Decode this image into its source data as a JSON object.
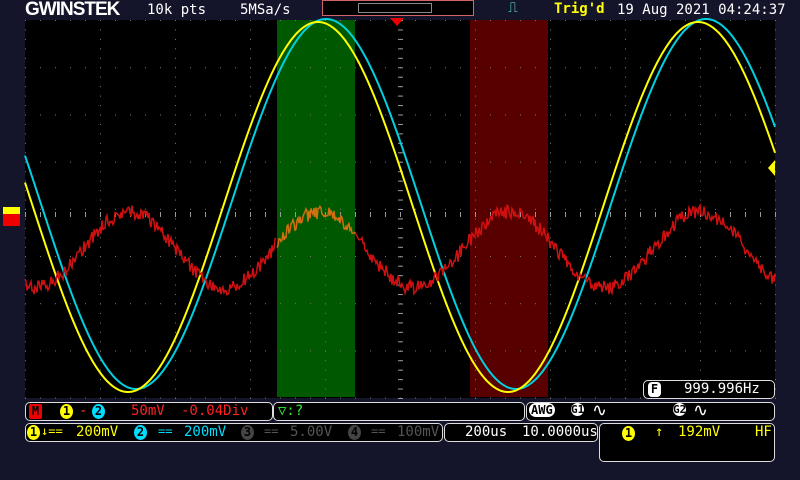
{
  "header": {
    "brand": "GWINSTEK",
    "record_length": "10k pts",
    "sample_rate": "5MSa/s",
    "trigger_status": "Trig'd",
    "datetime": "19 Aug 2021 04:24:37",
    "trigger_icon": "pulse-icon"
  },
  "frequency": {
    "label": "F",
    "value": "999.996Hz"
  },
  "math": {
    "label": "M",
    "src1": "1",
    "op": "-",
    "src2": "2",
    "scale": "50mV",
    "offset": "-0.04Div"
  },
  "bus": {
    "text": "▽:?"
  },
  "awg": {
    "label": "AWG",
    "g1": "G1",
    "g2": "G2",
    "g1_wave": "sine-icon",
    "g2_wave": "sine-icon"
  },
  "channels": [
    {
      "num": "1",
      "coupling": "↓==",
      "scale": "200mV",
      "color": "#ffff00"
    },
    {
      "num": "2",
      "coupling": "==",
      "scale": "200mV",
      "color": "#00e5ff"
    },
    {
      "num": "3",
      "coupling": "==",
      "scale": "5.00V",
      "color": "#555555"
    },
    {
      "num": "4",
      "coupling": "==",
      "scale": "100mV",
      "color": "#555555"
    }
  ],
  "timebase": {
    "scale": "200us",
    "position": "10.0000us"
  },
  "trigger": {
    "source": "1",
    "slope": "rising",
    "level": "192mV",
    "coupling": "HF"
  },
  "colors": {
    "ch1": "#ffff00",
    "ch2": "#00d0e0",
    "math": "#d01010",
    "cursor_a": "#006000",
    "cursor_b": "#600000"
  }
}
